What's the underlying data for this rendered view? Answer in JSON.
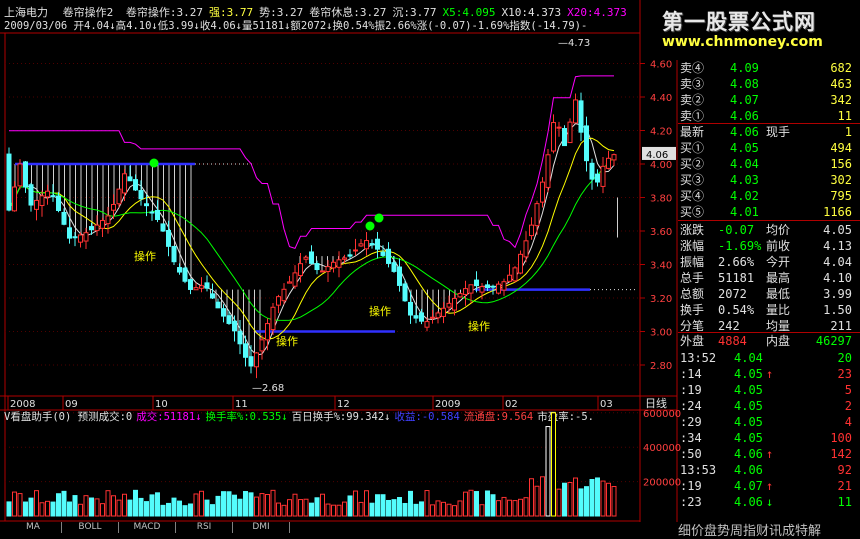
{
  "header": {
    "stock_name": "上海电力",
    "indicator_title": "卷帘操作2",
    "line1_items": [
      {
        "label": "卷帘操作:",
        "value": "3.27",
        "color": "#e0e0e0"
      },
      {
        "label": "强:",
        "value": "3.77",
        "color": "#ffff40"
      },
      {
        "label": "势:",
        "value": "3.27",
        "color": "#e0e0e0"
      },
      {
        "label": "卷帘休息:",
        "value": "3.27",
        "color": "#e0e0e0"
      },
      {
        "label": "沉:",
        "value": "3.77",
        "color": "#e0e0e0"
      },
      {
        "label": "X5:",
        "value": "4.095",
        "color": "#00ff00"
      },
      {
        "label": "X10:",
        "value": "4.373",
        "color": "#e0e0e0"
      },
      {
        "label": "X20:",
        "value": "4.373",
        "color": "#ff00ff"
      }
    ],
    "line2": "2009/03/06  开4.04↓高4.10↓低3.99↓收4.06↓量51181↓额2072↓换0.54%振2.66%涨(-0.07)-1.69%指数(-14.79)-"
  },
  "price_axis": [
    "4.60",
    "4.40",
    "4.20",
    "4.00",
    "3.80",
    "3.60",
    "3.40",
    "3.20",
    "3.00",
    "2.80"
  ],
  "current_price_tag": "4.06",
  "annotations": {
    "high": "4.73",
    "low": "2.68",
    "op1": "操作",
    "op2": "操作",
    "op3": "操作",
    "op4": "操作"
  },
  "months": [
    "2008",
    "09",
    "10",
    "11",
    "12",
    "2009",
    "02",
    "03"
  ],
  "period_label": "日线",
  "volume_panel": {
    "title_items": [
      {
        "text": "V看盘助手(0) 预测成交:0",
        "color": "#e0e0e0"
      },
      {
        "text": "成交:51181↓",
        "color": "#ff00ff"
      },
      {
        "text": "换手率%:0.535↓",
        "color": "#00ff00"
      },
      {
        "text": "百日换手%:99.342↓",
        "color": "#e0e0e0"
      },
      {
        "text": "收益:-0.584",
        "color": "#4040ff"
      },
      {
        "text": "流通盘:9.564",
        "color": "#ff4040"
      },
      {
        "text": "市盈率:-5.",
        "color": "#e0e0e0"
      }
    ],
    "axis": [
      "600000",
      "400000",
      "200000"
    ]
  },
  "tabs": [
    "MA",
    "BOLL",
    "MACD",
    "RSI",
    "DMI"
  ],
  "watermark": {
    "cn": "第一股票公式网",
    "url": "www.chnmoney.com"
  },
  "orderbook": {
    "asks": [
      {
        "label": "卖④",
        "price": "4.09",
        "vol": "682"
      },
      {
        "label": "卖③",
        "price": "4.08",
        "vol": "463"
      },
      {
        "label": "卖②",
        "price": "4.07",
        "vol": "342"
      },
      {
        "label": "卖①",
        "price": "4.06",
        "vol": "11"
      }
    ],
    "latest": {
      "label": "最新",
      "price": "4.06",
      "label2": "现手",
      "vol": "1"
    },
    "bids": [
      {
        "label": "买①",
        "price": "4.05",
        "vol": "494"
      },
      {
        "label": "买②",
        "price": "4.04",
        "vol": "156"
      },
      {
        "label": "买③",
        "price": "4.03",
        "vol": "302"
      },
      {
        "label": "买④",
        "price": "4.02",
        "vol": "795"
      },
      {
        "label": "买⑤",
        "price": "4.01",
        "vol": "1166"
      }
    ],
    "stats": [
      {
        "l1": "涨跌",
        "v1": "-0.07",
        "l2": "均价",
        "v2": "4.05"
      },
      {
        "l1": "涨幅",
        "v1": "-1.69%",
        "l2": "前收",
        "v2": "4.13"
      },
      {
        "l1": "振幅",
        "v1": "2.66%",
        "l2": "今开",
        "v2": "4.04"
      },
      {
        "l1": "总手",
        "v1": "51181",
        "l2": "最高",
        "v2": "4.10"
      },
      {
        "l1": "总额",
        "v1": "2072",
        "l2": "最低",
        "v2": "3.99"
      },
      {
        "l1": "换手",
        "v1": "0.54%",
        "l2": "量比",
        "v2": "1.50"
      },
      {
        "l1": "分笔",
        "v1": "242",
        "l2": "均量",
        "v2": "211"
      }
    ],
    "outer": {
      "label": "外盘",
      "vol": "4884",
      "label2": "内盘",
      "vol2": "46297"
    }
  },
  "ticks": [
    {
      "time": "13:52",
      "price": "4.04",
      "arrow": "",
      "vol": "20",
      "dir": "down"
    },
    {
      "time": ":14",
      "price": "4.05",
      "arrow": "↑",
      "vol": "23",
      "dir": "up"
    },
    {
      "time": ":19",
      "price": "4.05",
      "arrow": "",
      "vol": "5",
      "dir": "up"
    },
    {
      "time": ":24",
      "price": "4.05",
      "arrow": "",
      "vol": "2",
      "dir": "up"
    },
    {
      "time": ":29",
      "price": "4.05",
      "arrow": "",
      "vol": "4",
      "dir": "up"
    },
    {
      "time": ":34",
      "price": "4.05",
      "arrow": "",
      "vol": "100",
      "dir": "up"
    },
    {
      "time": ":50",
      "price": "4.06",
      "arrow": "↑",
      "vol": "142",
      "dir": "up"
    },
    {
      "time": "13:53",
      "price": "4.06",
      "arrow": "",
      "vol": "92",
      "dir": "up"
    },
    {
      "time": ":19",
      "price": "4.07",
      "arrow": "↑",
      "vol": "21",
      "dir": "up"
    },
    {
      "time": ":23",
      "price": "4.06",
      "arrow": "↓",
      "vol": "11",
      "dir": "down"
    }
  ],
  "bottom_text": "细价盘势周指财讯成特解",
  "colors": {
    "up": "#ff3232",
    "down": "#54fcfc",
    "grid": "#800000",
    "yellow": "#ffff00",
    "magenta": "#ff00ff",
    "green": "#00ff00",
    "blue": "#3030ff",
    "white": "#ffffff"
  }
}
